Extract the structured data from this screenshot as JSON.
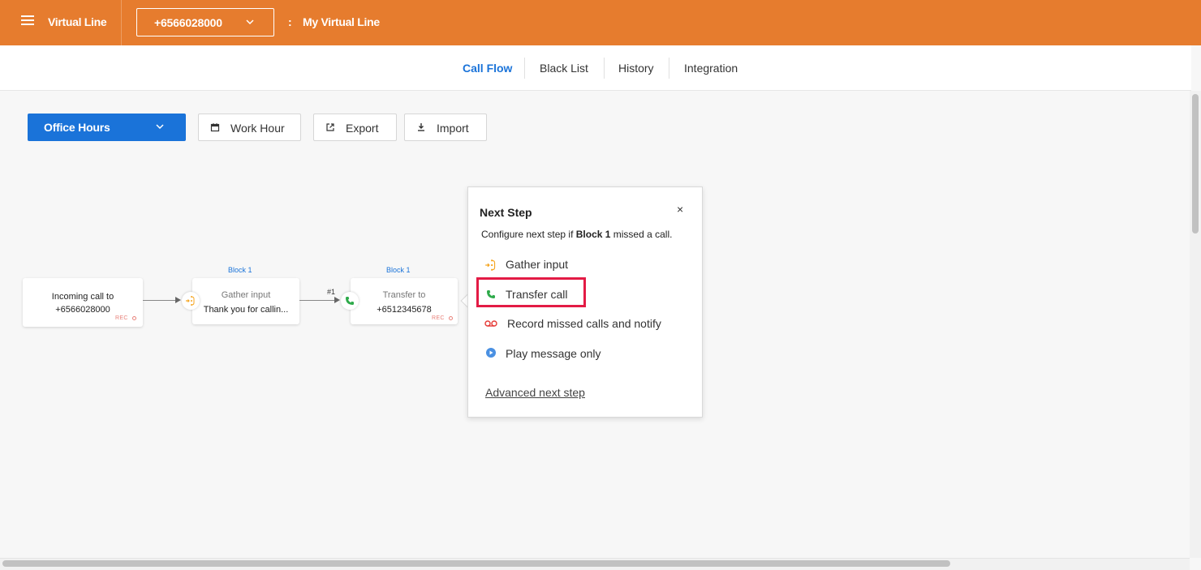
{
  "header": {
    "title": "Virtual Line",
    "number_select": "+6566028000",
    "separator": ":",
    "line_name": "My Virtual Line"
  },
  "tabs": [
    {
      "label": "Call Flow",
      "active": true
    },
    {
      "label": "Black List",
      "active": false
    },
    {
      "label": "History",
      "active": false
    },
    {
      "label": "Integration",
      "active": false
    }
  ],
  "toolbar": {
    "schedule_select": "Office Hours",
    "work_hour_label": "Work Hour",
    "export_label": "Export",
    "import_label": "Import"
  },
  "flow": {
    "incoming": {
      "line1": "Incoming call to",
      "line2": "+6566028000",
      "rec": "REC"
    },
    "gather": {
      "block": "Block 1",
      "title": "Gather input",
      "text": "Thank you for callin..."
    },
    "edge_label": "#1",
    "transfer": {
      "block": "Block 1",
      "title": "Transfer to",
      "number": "+6512345678",
      "rec": "REC"
    }
  },
  "popover": {
    "title": "Next Step",
    "close": "×",
    "desc_prefix": "Configure next step if ",
    "desc_block": "Block 1",
    "desc_suffix": " missed a call.",
    "options": [
      {
        "label": "Gather input",
        "icon": "gather-input-icon"
      },
      {
        "label": "Transfer call",
        "icon": "phone-icon"
      },
      {
        "label": "Record missed calls and notify",
        "icon": "voicemail-icon"
      },
      {
        "label": "Play message only",
        "icon": "play-icon"
      }
    ],
    "advanced": "Advanced next step"
  },
  "colors": {
    "header_bg": "#e67c2e",
    "accent": "#1a73d9",
    "highlight": "#e31b45",
    "gather_icon": "#f5a623",
    "phone_icon": "#2eaa4a",
    "voicemail_icon": "#e53935"
  }
}
